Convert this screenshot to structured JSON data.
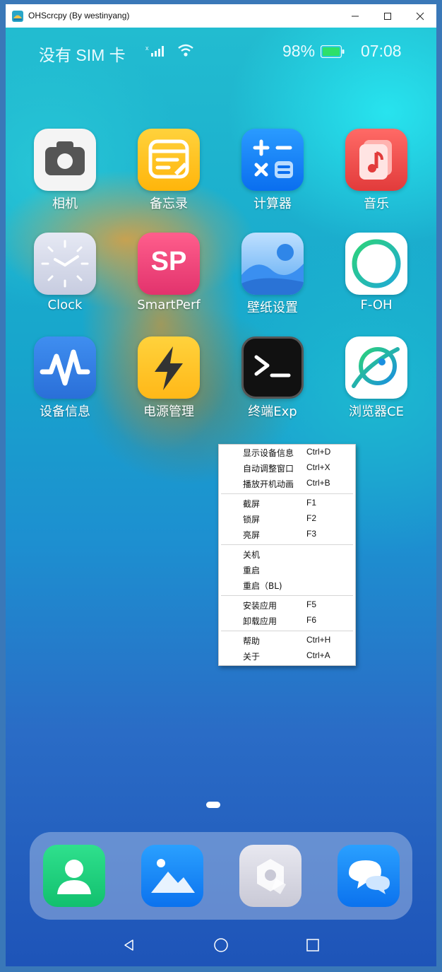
{
  "window": {
    "title": "OHScrcpy (By westinyang)"
  },
  "status_bar": {
    "carrier": "没有 SIM 卡",
    "battery": "98%",
    "time": "07:08"
  },
  "apps": [
    {
      "label": "相机",
      "icon": "camera-icon"
    },
    {
      "label": "备忘录",
      "icon": "notes-icon"
    },
    {
      "label": "计算器",
      "icon": "calculator-icon"
    },
    {
      "label": "音乐",
      "icon": "music-icon"
    },
    {
      "label": "Clock",
      "icon": "clock-icon"
    },
    {
      "label": "SmartPerf",
      "icon": "smartperf-icon",
      "icon_text": "SP"
    },
    {
      "label": "壁纸设置",
      "icon": "wallpaper-icon"
    },
    {
      "label": "F-OH",
      "icon": "f-oh-icon"
    },
    {
      "label": "设备信息",
      "icon": "device-info-icon"
    },
    {
      "label": "电源管理",
      "icon": "power-icon"
    },
    {
      "label": "终端Exp",
      "icon": "terminal-icon"
    },
    {
      "label": "浏览器CE",
      "icon": "browser-icon"
    }
  ],
  "context_menu": {
    "items": [
      {
        "label": "显示设备信息",
        "shortcut": "Ctrl+D"
      },
      {
        "label": "自动调整窗口",
        "shortcut": "Ctrl+X"
      },
      {
        "label": "播放开机动画",
        "shortcut": "Ctrl+B"
      },
      {
        "label": "截屏",
        "shortcut": "F1"
      },
      {
        "label": "锁屏",
        "shortcut": "F2"
      },
      {
        "label": "亮屏",
        "shortcut": "F3"
      },
      {
        "label": "关机",
        "shortcut": ""
      },
      {
        "label": "重启",
        "shortcut": ""
      },
      {
        "label": "重启（BL)",
        "shortcut": ""
      },
      {
        "label": "安装应用",
        "shortcut": "F5"
      },
      {
        "label": "卸载应用",
        "shortcut": "F6"
      },
      {
        "label": "帮助",
        "shortcut": "Ctrl+H"
      },
      {
        "label": "关于",
        "shortcut": "Ctrl+A"
      }
    ]
  },
  "dock": [
    {
      "icon": "contacts-icon"
    },
    {
      "icon": "gallery-icon"
    },
    {
      "icon": "settings-icon"
    },
    {
      "icon": "messages-icon"
    }
  ],
  "nav": [
    "back-icon",
    "home-icon",
    "recents-icon"
  ]
}
